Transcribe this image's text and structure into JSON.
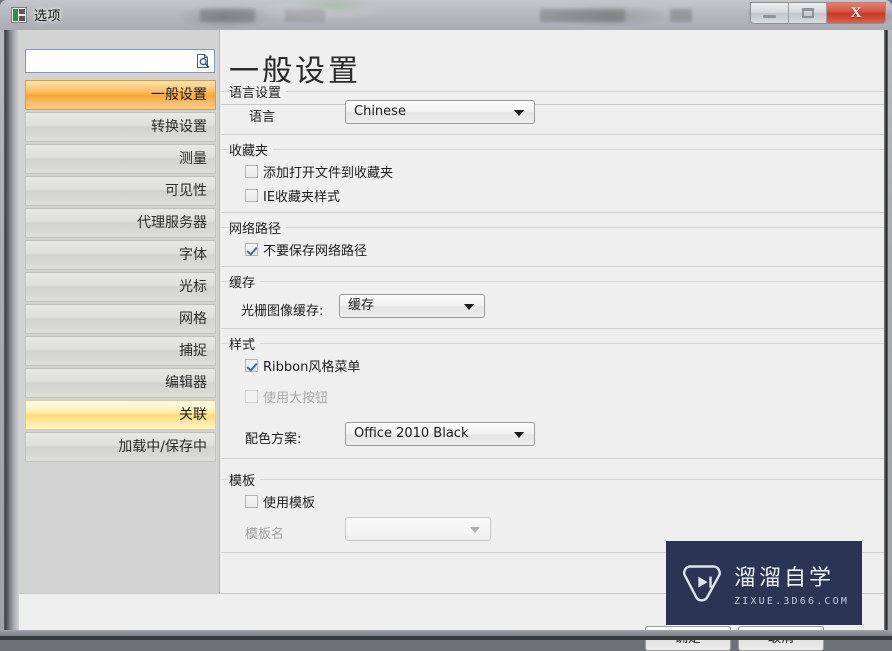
{
  "window": {
    "title": "选项",
    "icon": "options-icon",
    "caption_buttons": [
      {
        "name": "minimize-button",
        "glyph": "minimize-icon",
        "label": ""
      },
      {
        "name": "maximize-button",
        "glyph": "maximize-icon",
        "label": ""
      },
      {
        "name": "close-button",
        "glyph": "close-icon",
        "label": "X"
      }
    ]
  },
  "sidebar": {
    "search": {
      "value": "",
      "placeholder": "",
      "icon": "search-document-icon"
    },
    "items": [
      {
        "label": "一般设置",
        "state": "selected"
      },
      {
        "label": "转换设置",
        "state": "normal"
      },
      {
        "label": "测量",
        "state": "normal"
      },
      {
        "label": "可见性",
        "state": "normal"
      },
      {
        "label": "代理服务器",
        "state": "normal"
      },
      {
        "label": "字体",
        "state": "normal"
      },
      {
        "label": "光标",
        "state": "normal"
      },
      {
        "label": "网格",
        "state": "normal"
      },
      {
        "label": "捕捉",
        "state": "normal"
      },
      {
        "label": "编辑器",
        "state": "normal"
      },
      {
        "label": "关联",
        "state": "hover"
      },
      {
        "label": "加载中/保存中",
        "state": "normal"
      }
    ]
  },
  "content": {
    "page_title": "一般设置",
    "groups": {
      "language": {
        "title": "语言设置",
        "label": "语言",
        "combo_value": "Chinese"
      },
      "favorites": {
        "title": "收藏夹",
        "checkbox_add_open_file": {
          "label": "添加打开文件到收藏夹",
          "checked": false
        },
        "checkbox_ie_style": {
          "label": "IE收藏夹样式",
          "checked": false
        }
      },
      "network": {
        "title": "网络路径",
        "checkbox_no_save": {
          "label": "不要保存网络路径",
          "checked": true
        }
      },
      "cache": {
        "title": "缓存",
        "label": "光栅图像缓存:",
        "combo_value": "缓存"
      },
      "style": {
        "title": "样式",
        "checkbox_ribbon": {
          "label": "Ribbon风格菜单",
          "checked": true
        },
        "checkbox_big_buttons": {
          "label": "使用大按钮",
          "checked": false,
          "disabled": true
        },
        "label_scheme": "配色方案:",
        "combo_scheme_value": "Office 2010 Black"
      },
      "template": {
        "title": "模板",
        "checkbox_use_template": {
          "label": "使用模板",
          "checked": false
        },
        "label_template_name": "模板名",
        "combo_template_value": ""
      }
    }
  },
  "footer": {
    "ok_label": "确定",
    "cancel_label": "取消"
  },
  "watermark": {
    "title": "溜溜自学",
    "subtitle": "ZIXUE.3D66.COM",
    "icon": "play-logo-icon",
    "background": "#2b3553"
  },
  "colors": {
    "selected_accent": "#f8a833",
    "hover_accent": "#fbdd76",
    "content_background": "#efeff0",
    "sidebar_background": "#d3d3d3"
  }
}
